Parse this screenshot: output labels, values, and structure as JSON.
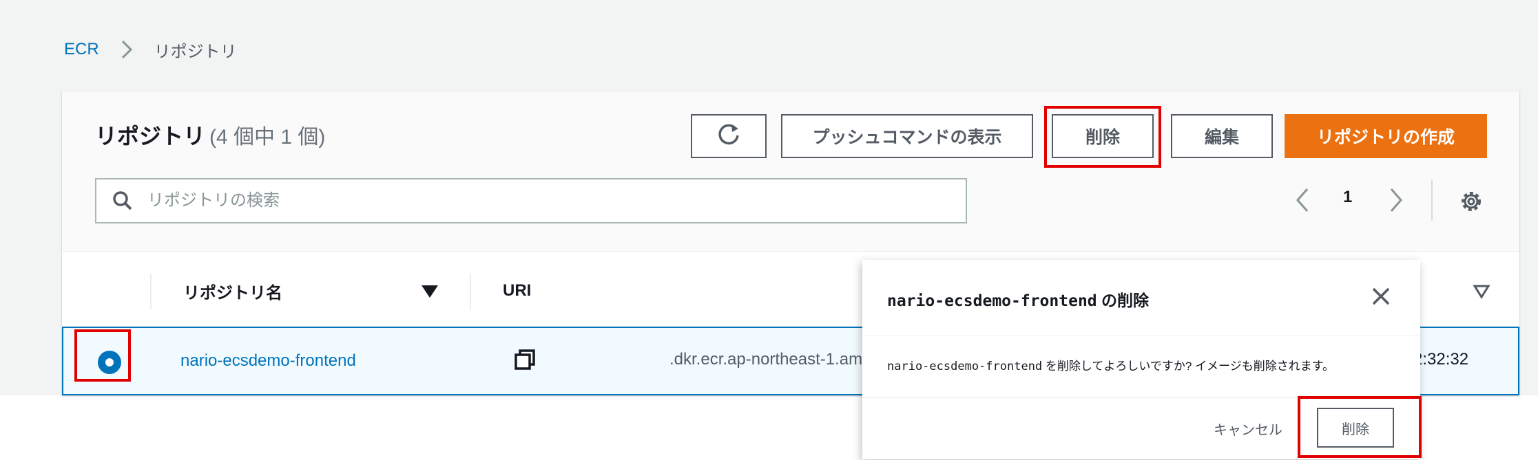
{
  "breadcrumb": {
    "root": "ECR",
    "current": "リポジトリ"
  },
  "panel": {
    "title": "リポジトリ",
    "count": "(4 個中 1 個)",
    "buttons": {
      "push": "プッシュコマンドの表示",
      "delete": "削除",
      "edit": "編集",
      "create": "リポジトリの作成"
    },
    "search_placeholder": "リポジトリの検索",
    "page": "1"
  },
  "table": {
    "columns": [
      "リポジトリ名",
      "URI"
    ],
    "row": {
      "name": "nario-ecsdemo-frontend",
      "uri": ".dkr.ecr.ap-northeast-1.am",
      "time": "2:32:32"
    }
  },
  "modal": {
    "title_name": "nario-ecsdemo-frontend",
    "title_suffix": " の削除",
    "body_name": "nario-ecsdemo-frontend",
    "body_suffix": " を削除してよろしいですか? イメージも削除されます。",
    "cancel": "キャンセル",
    "confirm": "削除"
  },
  "colors": {
    "primary": "#ec7211",
    "link": "#0073bb",
    "highlight": "#e00000"
  }
}
